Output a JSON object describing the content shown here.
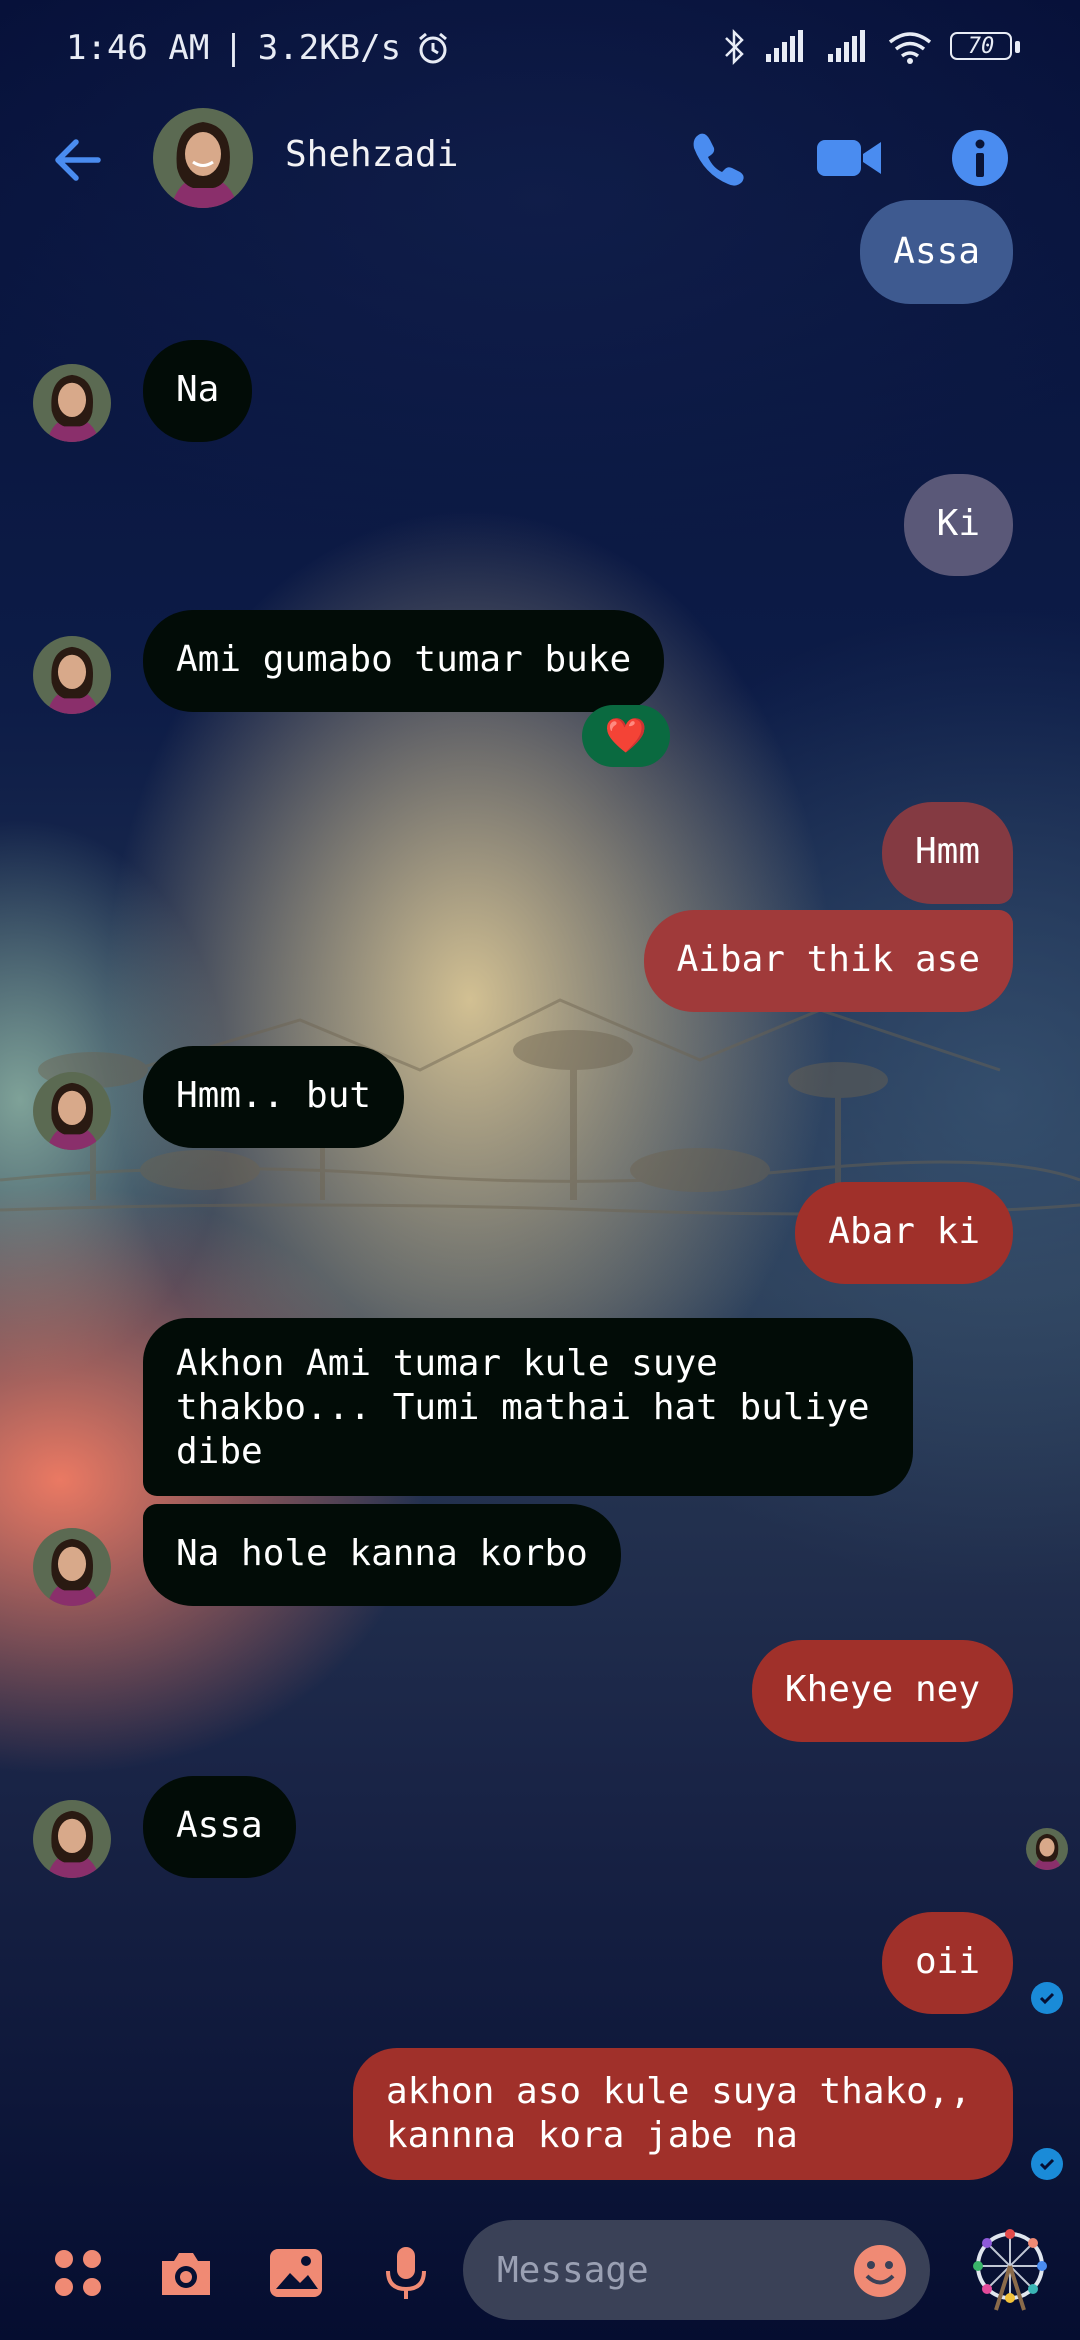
{
  "status_bar": {
    "time": "1:46 AM",
    "separator": "|",
    "speed": "3.2KB/s",
    "battery": "70"
  },
  "header": {
    "contact_name": "Shehzadi"
  },
  "messages": [
    {
      "dir": "out",
      "text": "Assa"
    },
    {
      "dir": "in",
      "text": "Na"
    },
    {
      "dir": "out",
      "text": "Ki"
    },
    {
      "dir": "in",
      "text": "Ami gumabo tumar buke",
      "reaction": "❤️"
    },
    {
      "dir": "out",
      "text": "Hmm"
    },
    {
      "dir": "out",
      "text": "Aibar thik ase"
    },
    {
      "dir": "in",
      "text": "Hmm.. but"
    },
    {
      "dir": "out",
      "text": "Abar ki"
    },
    {
      "dir": "in",
      "text": "Akhon Ami tumar kule suye thakbo... Tumi mathai hat buliye dibe"
    },
    {
      "dir": "in",
      "text": "Na hole kanna korbo"
    },
    {
      "dir": "out",
      "text": "Kheye ney"
    },
    {
      "dir": "in",
      "text": "Assa"
    },
    {
      "dir": "out",
      "text": "oii"
    },
    {
      "dir": "out",
      "text": "akhon aso kule suya thako,, kannna kora jabe na"
    }
  ],
  "composer": {
    "placeholder": "Message"
  },
  "colors": {
    "accent_blue": "#4a8cf0",
    "composer_icon": "#f08a74",
    "outgoing_red": "#a83a30",
    "incoming": "#020c07"
  }
}
